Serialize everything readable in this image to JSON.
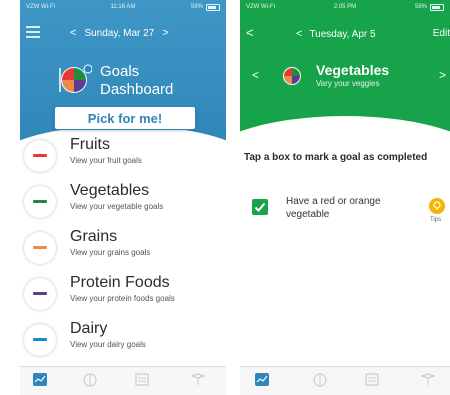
{
  "left": {
    "status": {
      "carrier": "VZW Wi-Fi",
      "time": "11:16 AM",
      "battery": "59%"
    },
    "nav": {
      "date": "Sunday, Mar 27",
      "prev": "<",
      "next": ">"
    },
    "dashboard": {
      "title_line1": "Goals",
      "title_line2": "Dashboard"
    },
    "pick_button": "Pick for me!",
    "food_groups": [
      {
        "name": "Fruits",
        "subtitle": "View your fruit goals",
        "color": "#e53935"
      },
      {
        "name": "Vegetables",
        "subtitle": "View your vegetable goals",
        "color": "#1e8e3e"
      },
      {
        "name": "Grains",
        "subtitle": "View your grains goals",
        "color": "#f08a4b"
      },
      {
        "name": "Protein Foods",
        "subtitle": "View your protein foods goals",
        "color": "#5c3c92"
      },
      {
        "name": "Dairy",
        "subtitle": "View your dairy goals",
        "color": "#1e88c8"
      }
    ]
  },
  "right": {
    "status": {
      "carrier": "VZW Wi-Fi",
      "time": "2:05 PM",
      "battery": "58%"
    },
    "nav": {
      "back": "<",
      "date": "Tuesday, Apr 5",
      "edit": "Edit",
      "prev": "<"
    },
    "group": {
      "title": "Vegetables",
      "subtitle": "Vary your veggies",
      "prev": "<",
      "next": ">"
    },
    "instruction": "Tap a box to mark a goal as completed",
    "goal": {
      "text": "Have a red or orange vegetable",
      "checked": true
    },
    "tips_label": "Tips"
  },
  "colors": {
    "blue_header": "#2f86b8",
    "green_header": "#16a34a",
    "tips": "#f5b400"
  },
  "icons": [
    "menu-icon",
    "chevron-left-icon",
    "chevron-right-icon",
    "myplate-icon",
    "checkmark-icon",
    "tips-lightbulb-icon",
    "dashboard-icon",
    "plate-icon",
    "tracker-icon",
    "resources-icon"
  ]
}
